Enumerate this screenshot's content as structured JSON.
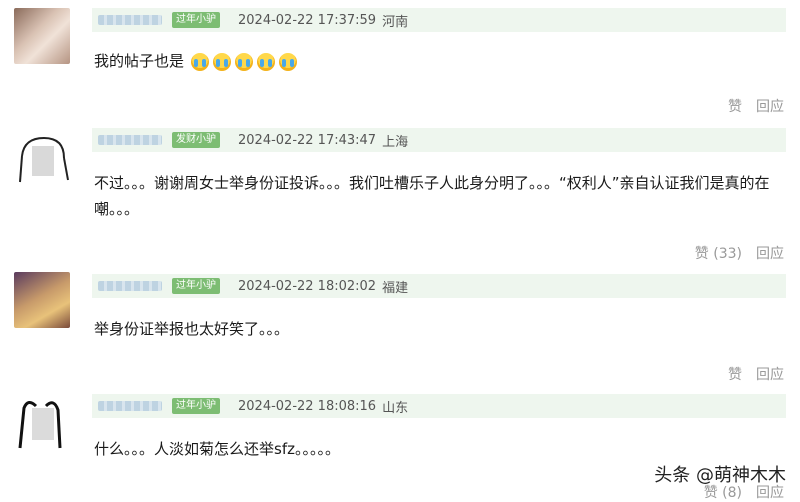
{
  "comments": [
    {
      "tag": "过年小驴",
      "datetime": "2024-02-22 17:37:59",
      "location": "河南",
      "text": "我的帖子也是",
      "emojis": [
        "loudly-crying-face",
        "loudly-crying-face",
        "loudly-crying-face",
        "loudly-crying-face",
        "loudly-crying-face"
      ],
      "like_label": "赞",
      "reply_label": "回应"
    },
    {
      "tag": "发财小驴",
      "datetime": "2024-02-22 17:43:47",
      "location": "上海",
      "text": "不过。。。谢谢周女士举身份证投诉。。。我们吐槽乐子人此身分明了。。。“权利人”亲自认证我们是真的在嘲。。。",
      "like_label": "赞 (33)",
      "reply_label": "回应"
    },
    {
      "tag": "过年小驴",
      "datetime": "2024-02-22 18:02:02",
      "location": "福建",
      "text": "举身份证举报也太好笑了。。。",
      "like_label": "赞",
      "reply_label": "回应"
    },
    {
      "tag": "过年小驴",
      "datetime": "2024-02-22 18:08:16",
      "location": "山东",
      "text": "什么。。。人淡如菊怎么还举sfz。。。。。",
      "like_label": "赞 (8)",
      "reply_label": "回应"
    }
  ],
  "watermark": "头条 @萌神木木",
  "colors": {
    "meta_bar": "#eef6ee",
    "tag": "#7dbd73",
    "action": "#999999"
  }
}
